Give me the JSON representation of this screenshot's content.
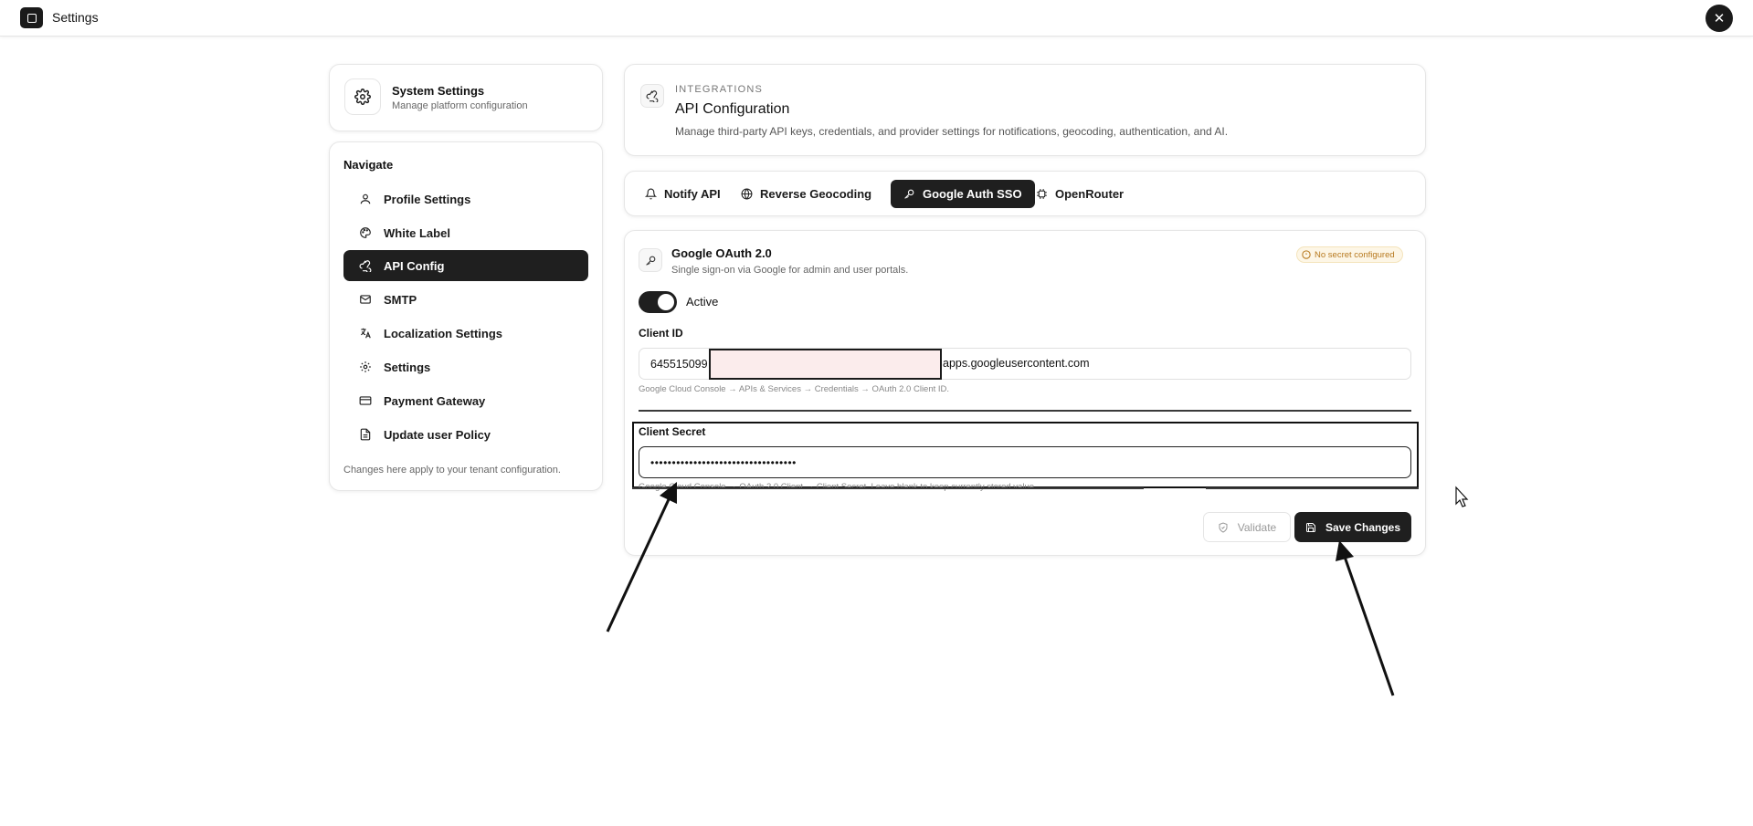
{
  "topbar": {
    "title": "Settings",
    "app_icon": "square-icon",
    "close_icon": "close-icon",
    "close_label": "✕"
  },
  "system_card": {
    "title": "System Settings",
    "subtitle": "Manage platform configuration",
    "icon": "gear-icon"
  },
  "nav": {
    "heading": "Navigate",
    "items": [
      {
        "label": "Profile Settings",
        "icon": "user-icon",
        "active": false
      },
      {
        "label": "White Label",
        "icon": "palette-icon",
        "active": false
      },
      {
        "label": "API Config",
        "icon": "webhook-icon",
        "active": true
      },
      {
        "label": "SMTP",
        "icon": "mail-icon",
        "active": false
      },
      {
        "label": "Localization Settings",
        "icon": "translate-icon",
        "active": false
      },
      {
        "label": "Settings",
        "icon": "gear-icon",
        "active": false
      },
      {
        "label": "Payment Gateway",
        "icon": "credit-card-icon",
        "active": false
      },
      {
        "label": "Update user Policy",
        "icon": "document-icon",
        "active": false
      }
    ],
    "footer": "Changes here apply to your tenant configuration."
  },
  "header": {
    "kicker": "INTEGRATIONS",
    "title": "API Configuration",
    "description": "Manage third-party API keys, credentials, and provider settings for notifications, geocoding, authentication, and AI.",
    "icon": "webhook-icon"
  },
  "tabs": [
    {
      "label": "Notify API",
      "icon": "bell-icon",
      "active": false
    },
    {
      "label": "Reverse Geocoding",
      "icon": "globe-icon",
      "active": false
    },
    {
      "label": "Google Auth SSO",
      "icon": "key-icon",
      "active": true
    },
    {
      "label": "OpenRouter",
      "icon": "chip-icon",
      "active": false
    }
  ],
  "oauth": {
    "title": "Google OAuth 2.0",
    "subtitle": "Single sign-on via Google for admin and user portals.",
    "badge": "No secret configured",
    "toggle_label": "Active",
    "toggle_on": true,
    "client_id_label": "Client ID",
    "client_id_prefix": "645515099",
    "client_id_suffix": "apps.googleusercontent.com",
    "client_id_hint": "Google Cloud Console → APIs & Services → Credentials → OAuth 2.0 Client ID.",
    "client_secret_label": "Client Secret",
    "client_secret_value": "••••••••••••••••••••••••••••••••••",
    "client_secret_hint": "Google Cloud Console → OAuth 2.0 Client → Client Secret. Leave blank to keep currently stored value.",
    "validate_label": "Validate",
    "save_label": "Save Changes"
  },
  "colors": {
    "accent": "#1f1f1f",
    "badge_text": "#b7791f",
    "badge_bg": "#fdf6e6",
    "redaction": "#fbecec"
  }
}
